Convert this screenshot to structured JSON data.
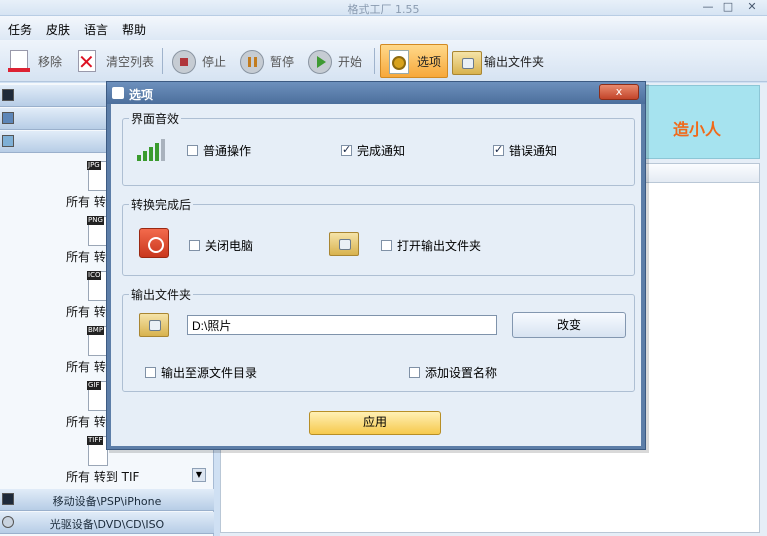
{
  "window": {
    "title": "格式工厂 1.55",
    "controls": [
      "—",
      "□",
      "✕"
    ]
  },
  "menu": [
    "任务",
    "皮肤",
    "语言",
    "帮助"
  ],
  "toolbar": {
    "remove": "移除",
    "clear_list": "清空列表",
    "stop": "停止",
    "pause": "暂停",
    "start": "开始",
    "options": "选项",
    "output_folder": "输出文件夹"
  },
  "left_panel": {
    "formats": [
      {
        "tag": "JPG",
        "label": "所有 转"
      },
      {
        "tag": "PNG",
        "label": "所有 转"
      },
      {
        "tag": "ICO",
        "label": "所有 转"
      },
      {
        "tag": "BMP",
        "label": "所有 转"
      },
      {
        "tag": "GIF",
        "label": "所有 转"
      },
      {
        "tag": "TIFF",
        "label": "所有 转到 TIF"
      }
    ],
    "categories_bottom": [
      "移动设备\\PSP\\iPhone",
      "光驱设备\\DVD\\CD\\ISO"
    ]
  },
  "right_panel": {
    "banner_text": "造小人"
  },
  "dialog": {
    "title": "选项",
    "close": "x",
    "sound_group": {
      "title": "界面音效",
      "normal_op": {
        "label": "普通操作",
        "checked": false
      },
      "done_notify": {
        "label": "完成通知",
        "checked": true
      },
      "error_notify": {
        "label": "错误通知",
        "checked": true
      }
    },
    "after_group": {
      "title": "转换完成后",
      "shutdown": {
        "label": "关闭电脑",
        "checked": false
      },
      "open_folder": {
        "label": "打开输出文件夹",
        "checked": false
      }
    },
    "output_group": {
      "title": "输出文件夹",
      "path": "D:\\照片",
      "change_button": "改变",
      "to_source_dir": {
        "label": "输出至源文件目录",
        "checked": false
      },
      "add_setting_name": {
        "label": "添加设置名称",
        "checked": false
      }
    },
    "apply_button": "应用"
  }
}
